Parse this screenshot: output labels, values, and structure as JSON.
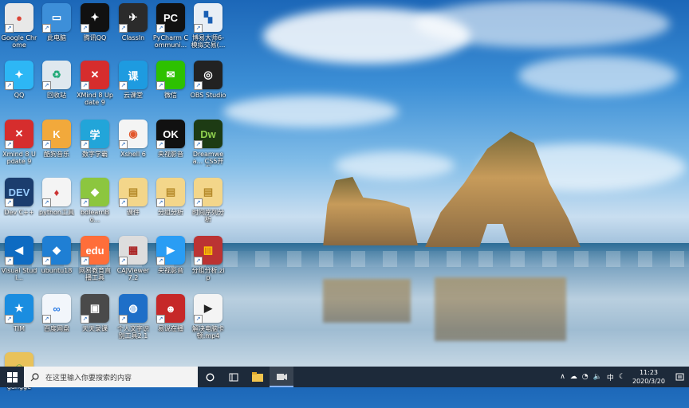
{
  "desktop": {
    "icons": [
      {
        "label": "Google Chrome",
        "glyph": "●",
        "color": "#e8e8e8",
        "fg": "#db4437",
        "name": "google-chrome-icon"
      },
      {
        "label": "QQ",
        "glyph": "✦",
        "color": "#2db7f5",
        "fg": "#fff",
        "name": "qq-icon"
      },
      {
        "label": "Xmind 8 Update 9",
        "glyph": "✕",
        "color": "#d62d2d",
        "fg": "#fff",
        "name": "xmind-icon"
      },
      {
        "label": "Dev C++",
        "glyph": "DEV",
        "color": "#1b3d6e",
        "fg": "#9cf",
        "name": "devcpp-icon"
      },
      {
        "label": "Visual Studi...",
        "glyph": "◀",
        "color": "#0e6bc2",
        "fg": "#fff",
        "name": "vscode-icon"
      },
      {
        "label": "TIM",
        "glyph": "★",
        "color": "#1a8de0",
        "fg": "#fff",
        "name": "tim-icon"
      },
      {
        "label": "gangge",
        "glyph": "☺",
        "color": "#e9c25a",
        "fg": "#5a4",
        "name": "folder-user-icon"
      },
      {
        "label": "此电脑",
        "glyph": "▭",
        "color": "#3d8fd9",
        "fg": "#fff",
        "name": "this-pc-icon"
      },
      {
        "label": "回收站",
        "glyph": "♻",
        "color": "#dfe8ee",
        "fg": "#2a7",
        "name": "recycle-bin-icon"
      },
      {
        "label": "酷狗音乐",
        "glyph": "K",
        "color": "#f2a93b",
        "fg": "#fff",
        "name": "kugou-icon"
      },
      {
        "label": "python工具",
        "glyph": "♦",
        "color": "#f4f4f4",
        "fg": "#c33",
        "name": "python-tool-icon"
      },
      {
        "label": "ubuntu18",
        "glyph": "◆",
        "color": "#1f7fd4",
        "fg": "#fff",
        "name": "ubuntu-vm-icon"
      },
      {
        "label": "百度网盘",
        "glyph": "∞",
        "color": "#f2f6fb",
        "fg": "#2a7be4",
        "name": "baidu-netdisk-icon"
      },
      {
        "label": "腾讯QQ",
        "glyph": "✦",
        "color": "#111",
        "fg": "#fff",
        "name": "tencent-qq-icon"
      },
      {
        "label": "XMind 8 Update 9",
        "glyph": "✕",
        "color": "#d62d2d",
        "fg": "#fff",
        "name": "xmind-8-icon"
      },
      {
        "label": "数字学霸",
        "glyph": "学",
        "color": "#22a5d9",
        "fg": "#fff",
        "name": "study-app-icon"
      },
      {
        "label": "bdlearnBo...",
        "glyph": "◆",
        "color": "#8cc63f",
        "fg": "#fff",
        "name": "bdlearn-icon"
      },
      {
        "label": "网易教育直播工具",
        "glyph": "edu",
        "color": "#ff6e3a",
        "fg": "#fff",
        "name": "netease-edu-icon"
      },
      {
        "label": "天天录课",
        "glyph": "▣",
        "color": "#4a4a4a",
        "fg": "#fff",
        "name": "tiantian-record-icon"
      },
      {
        "label": "ClassIn",
        "glyph": "✈",
        "color": "#2b2b2b",
        "fg": "#fff",
        "name": "classin-icon"
      },
      {
        "label": "云课堂",
        "glyph": "课",
        "color": "#1e9be0",
        "fg": "#fff",
        "name": "cloud-class-icon"
      },
      {
        "label": "Xshell 6",
        "glyph": "◉",
        "color": "#f4f4f4",
        "fg": "#e2552a",
        "name": "xshell-icon"
      },
      {
        "label": "课件",
        "glyph": "▤",
        "color": "#f3d68a",
        "fg": "#b58a2a",
        "name": "courseware-folder-icon"
      },
      {
        "label": "CAJViewer 7.2",
        "glyph": "▦",
        "color": "#ddd",
        "fg": "#a22",
        "name": "cajviewer-icon"
      },
      {
        "label": "个人文字识别工具2.1",
        "glyph": "◍",
        "color": "#1e6fc8",
        "fg": "#fff",
        "name": "ocr-tool-icon"
      },
      {
        "label": "PyCharm Communi...",
        "glyph": "PC",
        "color": "#111",
        "fg": "#fff",
        "name": "pycharm-icon"
      },
      {
        "label": "微信",
        "glyph": "✉",
        "color": "#2dc100",
        "fg": "#fff",
        "name": "wechat-icon"
      },
      {
        "label": "央视影音",
        "glyph": "OK",
        "color": "#111",
        "fg": "#fff",
        "name": "ok-player-icon"
      },
      {
        "label": "分组分析",
        "glyph": "▤",
        "color": "#f3d68a",
        "fg": "#b58a2a",
        "name": "group-analysis-folder-icon"
      },
      {
        "label": "央视影音",
        "glyph": "▶",
        "color": "#2a9df4",
        "fg": "#fff",
        "name": "cctv-player-icon"
      },
      {
        "label": "易说在播",
        "glyph": "☻",
        "color": "#c62828",
        "fg": "#fff",
        "name": "yishuo-live-icon"
      },
      {
        "label": "博易大师6-模拟交易(...",
        "glyph": "▚",
        "color": "#e8eef5",
        "fg": "#1a5fb4",
        "name": "boyi-master-icon"
      },
      {
        "label": "OBS Studio",
        "glyph": "◎",
        "color": "#222",
        "fg": "#fff",
        "name": "obs-studio-icon"
      },
      {
        "label": "Dreamwea... CS5开发",
        "glyph": "Dw",
        "color": "#1d3b14",
        "fg": "#8fd14f",
        "name": "dreamweaver-icon"
      },
      {
        "label": "时间序列分析",
        "glyph": "▤",
        "color": "#f3d68a",
        "fg": "#b58a2a",
        "name": "time-series-folder-icon"
      },
      {
        "label": "分组分析.zip",
        "glyph": "▥",
        "color": "#b33",
        "fg": "#fc0",
        "name": "zip-archive-icon"
      },
      {
        "label": "解决电脑卡顿.mp4",
        "glyph": "▶",
        "color": "#f4f4f4",
        "fg": "#222",
        "name": "video-file-icon"
      }
    ]
  },
  "taskbar": {
    "search_placeholder": "在这里输入你要搜索的内容",
    "ime": "中",
    "time": "11:23",
    "date": "2020/3/20"
  }
}
